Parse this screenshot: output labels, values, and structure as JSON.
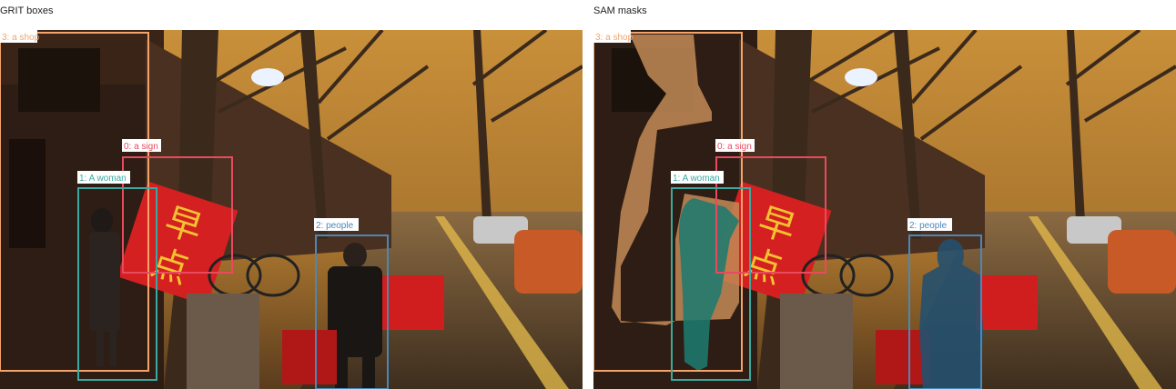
{
  "panels": [
    {
      "title": "GRIT boxes"
    },
    {
      "title": "SAM masks"
    }
  ],
  "detections": [
    {
      "id": 0,
      "label": "0: a sign",
      "color": "#e84a5f"
    },
    {
      "id": 1,
      "label": "1: A woman",
      "color": "#3aa99f"
    },
    {
      "id": 2,
      "label": "2: people",
      "color": "#4a88b8"
    },
    {
      "id": 3,
      "label": "3: a shop",
      "color": "#f4a36b"
    }
  ],
  "scene": {
    "sign_characters": [
      "早",
      "点"
    ]
  }
}
